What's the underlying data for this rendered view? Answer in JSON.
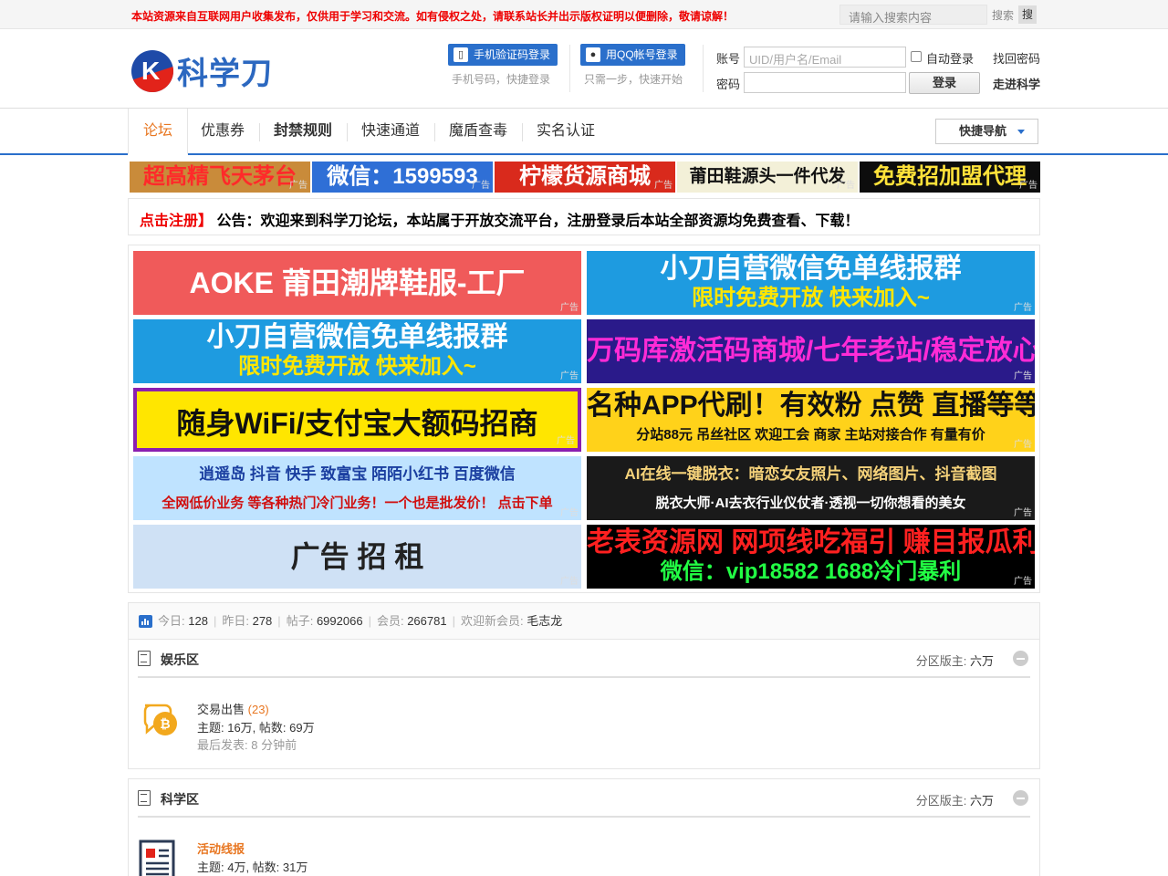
{
  "topbar": {
    "notice": "本站资源来自互联网用户收集发布，仅供用于学习和交流。如有侵权之处，请联系站长并出示版权证明以便删除，敬请谅解！",
    "search_placeholder": "请输入搜索内容",
    "search_label": "搜索",
    "search_button": "搜"
  },
  "header": {
    "logo_letter": "K",
    "logo_text": "科学刀",
    "phone_login": "手机验证码登录",
    "phone_sub": "手机号码，快捷登录",
    "qq_login": "用QQ帐号登录",
    "qq_sub": "只需一步，快速开始",
    "account_label": "账号",
    "account_placeholder": "UID/用户名/Email",
    "password_label": "密码",
    "auto_login": "自动登录",
    "login_button": "登录",
    "forgot_password": "找回密码",
    "about": "走进科学"
  },
  "nav": {
    "items": [
      "论坛",
      "优惠券",
      "封禁规则",
      "快速通道",
      "魔盾查毒",
      "实名认证"
    ],
    "quick_nav": "快捷导航"
  },
  "top_ads": [
    {
      "text": "超高精飞天茅台",
      "tag": "广告",
      "bg": "#c98b3a",
      "fg": "#ff2a2a"
    },
    {
      "text": "微信：1599593",
      "tag": "广告",
      "bg": "#2f6fd6",
      "fg": "#ffffff"
    },
    {
      "text": "柠檬货源商城",
      "tag": "广告",
      "bg": "#d92a1c",
      "fg": "#ffffff"
    },
    {
      "text": "莆田鞋源头一件代发",
      "tag": "广告",
      "bg": "#f3f0d8",
      "fg": "#111111"
    },
    {
      "text": "免费招加盟代理",
      "tag": "广告",
      "bg": "#0d0d0d",
      "fg": "#ffe23a"
    }
  ],
  "notice_bar": {
    "prefix": "点击注册】",
    "text": "公告：欢迎来到科学刀论坛，本站属于开放交流平台，注册登录后本站全部资源均免费查看、下载！"
  },
  "big_ads": [
    {
      "line1": "AOKE 莆田潮牌鞋服-工厂",
      "line2": "",
      "tag": "广告",
      "bg": "#f05a5a",
      "fg": "#ffffff"
    },
    {
      "line1": "小刀自营微信免单线报群",
      "line2": "限时免费开放 快来加入~",
      "tag": "广告",
      "bg": "#1e9be0",
      "fg": "#ffffff",
      "fg2": "#ffe600"
    },
    {
      "line1": "小刀自营微信免单线报群",
      "line2": "限时免费开放 快来加入~",
      "tag": "广告",
      "bg": "#1e9be0",
      "fg": "#ffffff",
      "fg2": "#ffe600"
    },
    {
      "line1": "万码库激活码商城/七年老站/稳定放心/",
      "line2": "",
      "tag": "广告",
      "bg": "#2a1a8a",
      "fg": "#ff2bd6"
    },
    {
      "line1": "随身WiFi/支付宝大额码招商",
      "line2": "",
      "tag": "广告",
      "bg": "#ffe600",
      "fg": "#111111"
    },
    {
      "line1": "名种APP代刷！有效粉 点赞 直播等等",
      "line2": "分站88元 吊丝社区 欢迎工会 商家 主站对接合作 有量有价",
      "tag": "广告",
      "bg": "#ffd21a",
      "fg": "#111111",
      "fg2": "#111111"
    },
    {
      "line1": "逍遥岛 抖音 快手 致富宝 陌陌小红书 百度微信",
      "line2": "全网低价业务 等各种热门冷门业务！一个也是批发价！ 点击下单",
      "tag": "广告",
      "bg": "#bfe3ff",
      "fg": "#1b3fa0",
      "fg2": "#d01010"
    },
    {
      "line1": "AI在线一键脱衣：暗恋女友照片、网络图片、抖音截图",
      "line2": "脱衣大师·AI去衣行业仪仗者·透视一切你想看的美女",
      "tag": "广告",
      "bg": "#1a1a1a",
      "fg": "#f5d27a",
      "fg2": "#ffffff"
    },
    {
      "line1": "广告 招 租",
      "line2": "",
      "tag": "广告",
      "bg": "#cfe1f5",
      "fg": "#222222"
    },
    {
      "line1": "老表资源网 网项线吃福引 赚目报瓜利流",
      "line2": "微信：vip18582 1688冷门暴利",
      "tag": "广告",
      "bg": "#000000",
      "fg": "#ff2020",
      "fg2": "#22ff44"
    }
  ],
  "stats": {
    "today_label": "今日:",
    "today": "128",
    "yesterday_label": "昨日:",
    "yesterday": "278",
    "posts_label": "帖子:",
    "posts": "6992066",
    "members_label": "会员:",
    "members": "266781",
    "newest_label": "欢迎新会员:",
    "newest": "毛志龙"
  },
  "sections": [
    {
      "title": "娱乐区",
      "moderator_label": "分区版主:",
      "moderator": "六万",
      "forum": {
        "name": "交易出售",
        "today_count": "(23)",
        "meta": "主题: 16万, 帖数: 69万",
        "last": "最后发表: 8 分钟前",
        "icon": "bitcoin-chat-icon",
        "name_color": "#333333"
      }
    },
    {
      "title": "科学区",
      "moderator_label": "分区版主:",
      "moderator": "六万",
      "forum": {
        "name": "活动线报",
        "today_count": "",
        "meta": "主题: 4万, 帖数: 31万",
        "last": "",
        "icon": "newspaper-icon",
        "name_color": "#e87722"
      }
    }
  ]
}
